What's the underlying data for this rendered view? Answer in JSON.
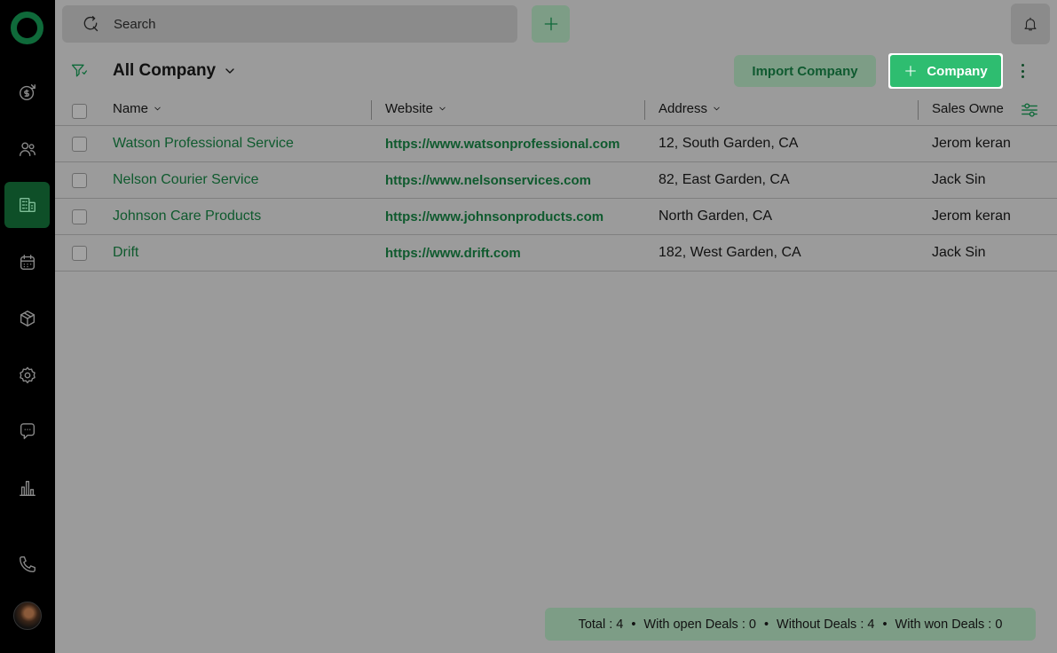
{
  "search": {
    "placeholder": "Search"
  },
  "header": {
    "view_title": "All Company",
    "import_label": "Import Company",
    "add_company_label": "Company"
  },
  "table": {
    "columns": [
      "Name",
      "Website",
      "Address",
      "Sales Owne"
    ],
    "rows": [
      {
        "name": "Watson Professional Service",
        "website": "https://www.watsonprofessional.com",
        "address": "12, South Garden, CA",
        "owner": "Jerom keran"
      },
      {
        "name": "Nelson Courier Service",
        "website": "https://www.nelsonservices.com",
        "address": "82, East Garden, CA",
        "owner": "Jack Sin"
      },
      {
        "name": "Johnson Care Products",
        "website": "https://www.johnsonproducts.com",
        "address": "North Garden, CA",
        "owner": "Jerom keran"
      },
      {
        "name": "Drift",
        "website": "https://www.drift.com",
        "address": "182, West Garden, CA",
        "owner": "Jack Sin"
      }
    ]
  },
  "summary": {
    "total": "Total : 4",
    "open_deals": "With open Deals : 0",
    "without_deals": "Without Deals : 4",
    "won_deals": "With won Deals : 0"
  },
  "sidebar": {
    "items": [
      "deals-icon",
      "contacts-icon",
      "companies-icon",
      "calendar-icon",
      "products-icon",
      "settings-icon",
      "messages-icon",
      "reports-icon",
      "phone-icon"
    ],
    "active": "companies-icon"
  },
  "colors": {
    "accent": "#2ebd70",
    "link": "#0f5a2e",
    "sidebar": "#000000"
  }
}
